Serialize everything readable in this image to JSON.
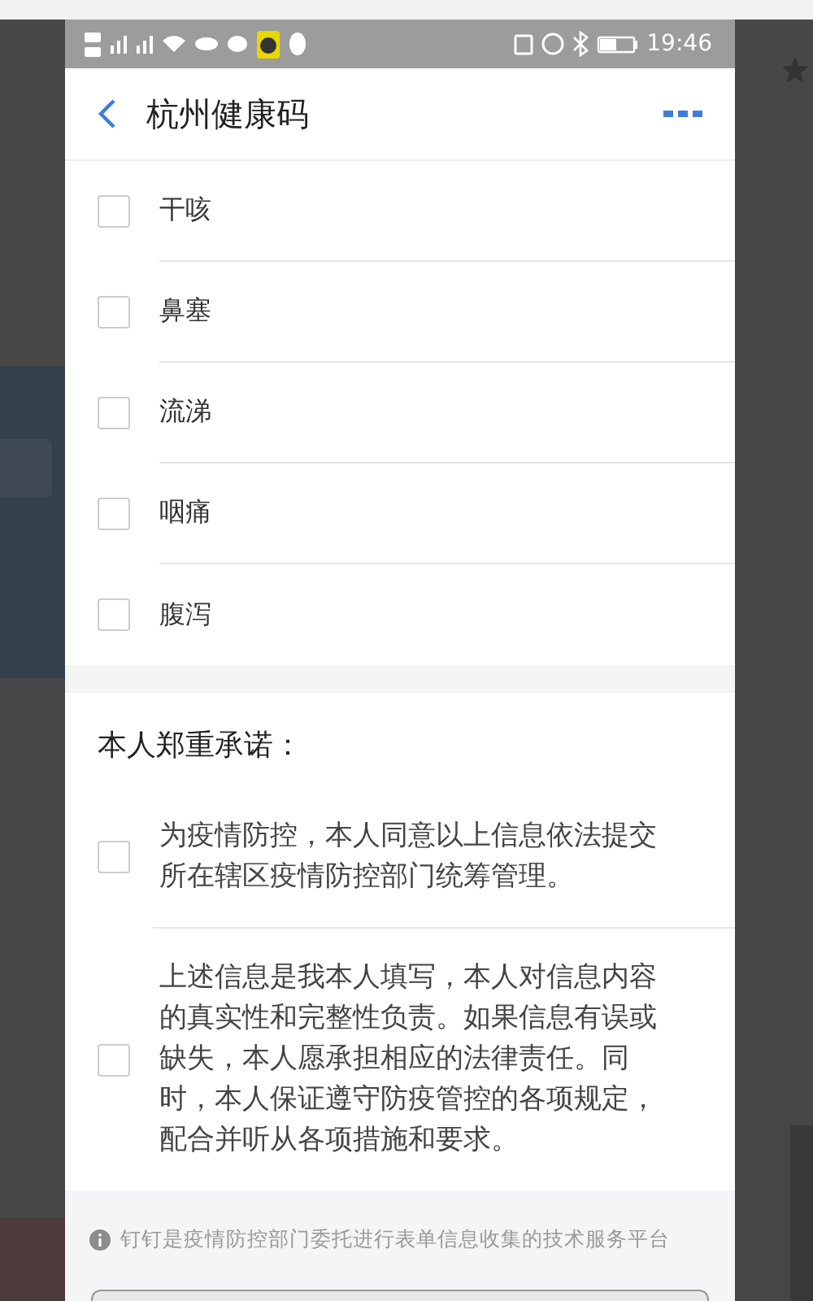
{
  "status_bar": {
    "time": "19:46"
  },
  "header": {
    "title": "杭州健康码"
  },
  "symptoms": [
    {
      "label": "干咳",
      "checked": false
    },
    {
      "label": "鼻塞",
      "checked": false
    },
    {
      "label": "流涕",
      "checked": false
    },
    {
      "label": "咽痛",
      "checked": false
    },
    {
      "label": "腹泻",
      "checked": false
    }
  ],
  "commitment": {
    "title": "本人郑重承诺：",
    "items": [
      {
        "text": "为疫情防控，本人同意以上信息依法提交所在辖区疫情防控部门统筹管理。",
        "checked": false
      },
      {
        "text": "上述信息是我本人填写，本人对信息内容的真实性和完整性负责。如果信息有误或缺失，本人愿承担相应的法律责任。同时，本人保证遵守防疫管控的各项规定，配合并听从各项措施和要求。",
        "checked": false
      }
    ]
  },
  "footer": {
    "note": "钉钉是疫情防控部门委托进行表单信息收集的技术服务平台"
  }
}
